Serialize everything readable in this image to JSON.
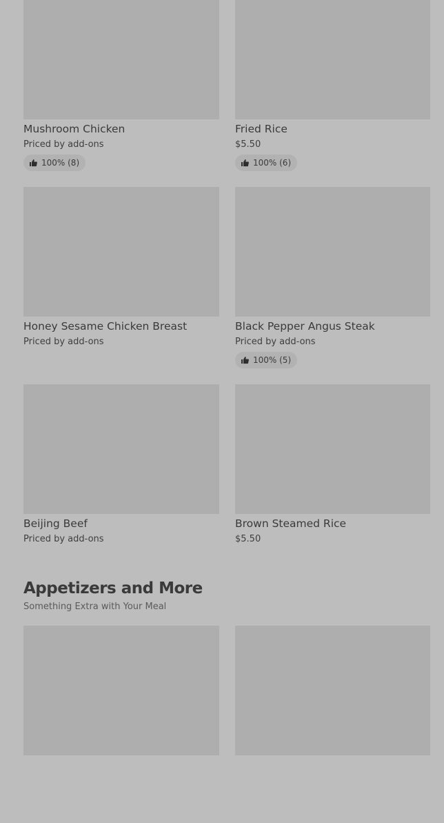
{
  "items": [
    {
      "name": "Mushroom Chicken",
      "price": "Priced by add-ons",
      "rating": "100% (8)"
    },
    {
      "name": "Fried Rice",
      "price": "$5.50",
      "rating": "100% (6)"
    },
    {
      "name": "Honey Sesame Chicken Breast",
      "price": "Priced by add-ons",
      "rating": ""
    },
    {
      "name": "Black Pepper Angus Steak",
      "price": "Priced by add-ons",
      "rating": "100% (5)"
    },
    {
      "name": "Beijing Beef",
      "price": "Priced by add-ons",
      "rating": ""
    },
    {
      "name": "Brown Steamed Rice",
      "price": "$5.50",
      "rating": ""
    }
  ],
  "section": {
    "title": "Appetizers and More",
    "subtitle": "Something Extra with Your Meal"
  },
  "icons": {
    "rating": "thumbs-up-icon"
  },
  "colors": {
    "background": "#bdbdbd",
    "image_placeholder": "#aeaeae",
    "badge": "#b2b2b2"
  }
}
